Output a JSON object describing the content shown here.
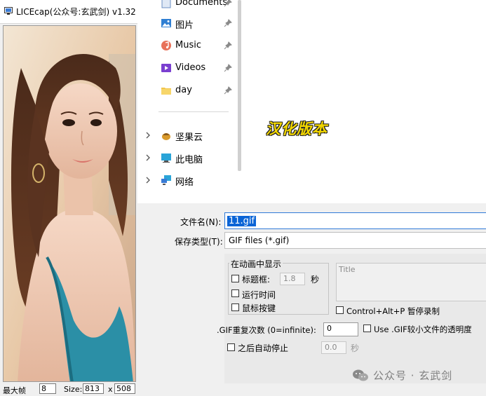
{
  "lice": {
    "title": "LICEcap(公众号:玄武剑) v1.32 [",
    "footer": {
      "max_fps_label": "最大帧",
      "max_fps_value": "8",
      "size_label": "Size:",
      "width": "813",
      "x_label": "x",
      "height": "508"
    }
  },
  "nav": {
    "quick_access": [
      {
        "label": "Documents",
        "icon": "documents-icon"
      },
      {
        "label": "图片",
        "icon": "pictures-icon"
      },
      {
        "label": "Music",
        "icon": "music-icon"
      },
      {
        "label": "Videos",
        "icon": "videos-icon"
      },
      {
        "label": "day",
        "icon": "folder-icon"
      }
    ],
    "locations": [
      {
        "label": "坚果云",
        "icon": "nutstore-icon"
      },
      {
        "label": "此电脑",
        "icon": "this-pc-icon"
      },
      {
        "label": "网络",
        "icon": "network-icon"
      }
    ]
  },
  "overlay_text": "汉化版本",
  "form": {
    "filename_label": "文件名(N):",
    "filename_value": "11.gif",
    "filetype_label": "保存类型(T):",
    "filetype_value": "GIF files (*.gif)"
  },
  "options": {
    "group_title": "在动画中显示",
    "title_frame_label": "标题框:",
    "title_frame_seconds": "1.8",
    "seconds_unit": "秒",
    "elapsed_time_label": "运行时间",
    "mouse_buttons_label": "鼠标按键",
    "title_placeholder": "Title",
    "pause_hotkey_label": "Control+Alt+P 暂停录制",
    "gif_repeat_label": ".GIF重复次数 (0=infinite):",
    "gif_repeat_value": "0",
    "transparency_label": "Use .GIF较小文件的透明度",
    "auto_stop_label": "之后自动停止",
    "auto_stop_value": "0.0",
    "auto_stop_unit": "秒"
  },
  "watermark": "公众号 · 玄武剑",
  "colors": {
    "selection": "#0a64d6",
    "overlay_text": "#f2d600"
  }
}
